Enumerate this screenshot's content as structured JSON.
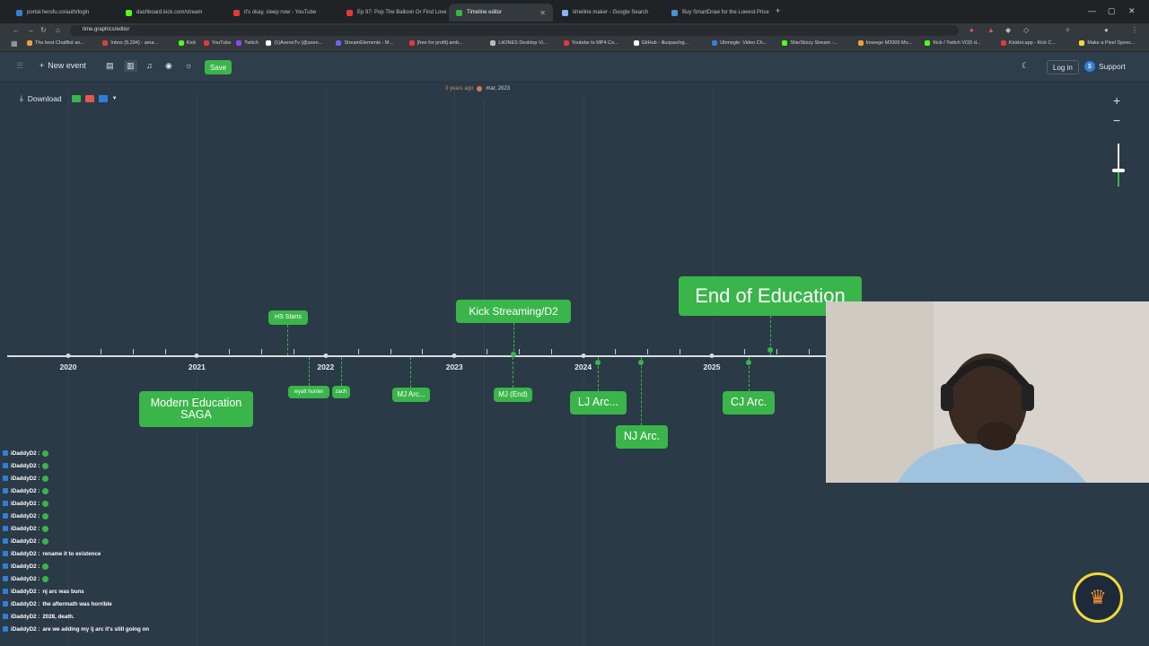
{
  "browser": {
    "tabs": [
      {
        "title": "portal.herofu.co/auth/login",
        "color": "#3b7bd8"
      },
      {
        "title": "dashboard.kick.com/stream",
        "color": "#53fc18"
      },
      {
        "title": "it's okay, sleep now - YouTube",
        "color": "#e53935"
      },
      {
        "title": "Ep 97: Pop The Balloon Or Find Love",
        "color": "#e53935"
      },
      {
        "title": "Timeline editor",
        "color": "#3ab54a"
      },
      {
        "title": "timeline maker - Google Search",
        "color": "#8ab4f8"
      },
      {
        "title": "Buy SmartDraw for the Lowest Price",
        "color": "#4a90d9"
      }
    ],
    "url": "time.graphics/editor",
    "bookmarks": [
      {
        "label": "The best ChatBot an...",
        "color": "#e8a33d"
      },
      {
        "label": "Inbox (5,294) - ama...",
        "color": "#d44638"
      },
      {
        "label": "Kick",
        "color": "#53fc18"
      },
      {
        "label": "YouTube",
        "color": "#e53935"
      },
      {
        "label": "Twitch",
        "color": "#9146ff"
      },
      {
        "label": "(1)AsenoTv (@asen...",
        "color": "#ffffff"
      },
      {
        "label": "StreamElements - M...",
        "color": "#6c63ff"
      },
      {
        "label": "[free for profit] amb...",
        "color": "#e53935"
      },
      {
        "label": "LitONES Desktop Vi...",
        "color": "#bbbbbb"
      },
      {
        "label": "Youtube to MP4 Co...",
        "color": "#e53935"
      },
      {
        "label": "GitHub - illuspas/ng...",
        "color": "#ffffff"
      },
      {
        "label": "Uhmegle: Video Ch...",
        "color": "#3b7bd8"
      },
      {
        "label": "ShieStizzy Stream -...",
        "color": "#53fc18"
      },
      {
        "label": "Inseego M2000 Mo...",
        "color": "#e8a33d"
      },
      {
        "label": "Kick / Twitch VOD d...",
        "color": "#53fc18"
      },
      {
        "label": "Kicklet.app - Kick C...",
        "color": "#e53935"
      },
      {
        "label": "Make a Pixel Speec...",
        "color": "#f2d83a"
      }
    ]
  },
  "toolbar": {
    "new_event": "New event",
    "save": "Save",
    "login": "Log in",
    "support": "Support"
  },
  "download": {
    "label": "Download"
  },
  "now_marker": {
    "ago": "3 years ago",
    "date": "mar, 2023"
  },
  "timeline": {
    "years": [
      "2020",
      "2021",
      "2022",
      "2023",
      "2024",
      "2025"
    ],
    "events_above": [
      {
        "label": "HS Starts"
      },
      {
        "label": "Kick Streaming/D2"
      },
      {
        "label": "End of Education"
      }
    ],
    "events_below": [
      {
        "label": "Modern Education SAGA"
      },
      {
        "label": "wyatt hunter"
      },
      {
        "label": "zach"
      },
      {
        "label": "MJ Arc..."
      },
      {
        "label": "MJ (End)"
      },
      {
        "label": "LJ Arc..."
      },
      {
        "label": "NJ Arc."
      },
      {
        "label": "CJ Arc."
      }
    ]
  },
  "chat": {
    "user": "iDaddyD2 :",
    "lines": [
      {
        "text": ""
      },
      {
        "text": ""
      },
      {
        "text": ""
      },
      {
        "text": ""
      },
      {
        "text": ""
      },
      {
        "text": ""
      },
      {
        "text": ""
      },
      {
        "text": ""
      },
      {
        "text": "rename it to existence"
      },
      {
        "text": ""
      },
      {
        "text": ""
      },
      {
        "text": "nj arc was buns"
      },
      {
        "text": "the aftermath was horrible"
      },
      {
        "text": "2028, death."
      },
      {
        "text": "are we adding my lj arc it's still going on"
      }
    ]
  },
  "colors": {
    "accent": "#3ab54a",
    "background": "#2b3a47",
    "crown": "#f2d83a"
  }
}
